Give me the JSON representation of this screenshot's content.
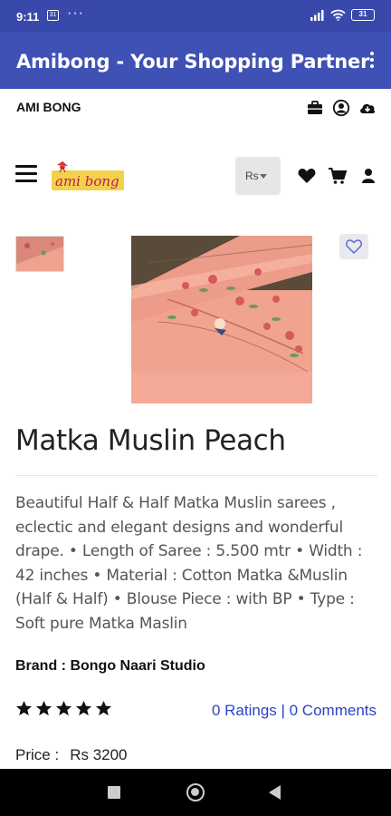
{
  "status_bar": {
    "time": "9:11",
    "badge": "31",
    "dots": "···",
    "battery": "31"
  },
  "app_bar": {
    "title": "Amibong - Your Shopping Partner"
  },
  "top_strip": {
    "brand": "AMI BONG"
  },
  "nav": {
    "currency": "Rs"
  },
  "logo": {
    "text": "ami bong"
  },
  "product": {
    "title": "Matka Muslin Peach",
    "description": "Beautiful Half & Half Matka Muslin sarees , eclectic and elegant designs and wonderful drape. • Length of Saree : 5.500 mtr • Width : 42 inches • Material : Cotton Matka &Muslin (Half & Half) • Blouse Piece : with BP • Type : Soft pure Matka Maslin",
    "brand": "Brand : Bongo Naari Studio",
    "rating_stars": 5,
    "ratings_link": "0 Ratings | 0 Comments",
    "price_label": "Price :",
    "price_value": "Rs 3200"
  },
  "colors": {
    "status_bar": "#3949ab",
    "app_bar": "#3f51b5",
    "link": "#2a43c8",
    "saree": "#f0a48f"
  }
}
